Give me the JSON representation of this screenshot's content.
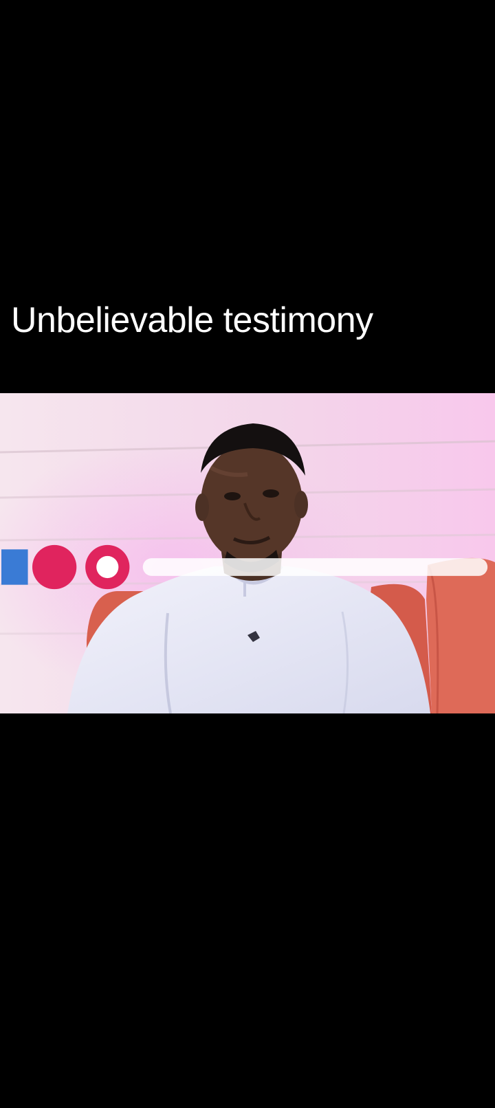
{
  "overlay_text": {
    "caption": "Unbelievable testimony"
  },
  "video": {
    "content": "studio-interview-frame",
    "watermark_icon": "channel-logo-icon"
  },
  "colors": {
    "background": "#000000",
    "caption_text": "#ffffff",
    "wall": "#f3dbe9",
    "sofa": "#d8604e",
    "shirt": "#e9eaf7",
    "skin": "#4e3326"
  }
}
